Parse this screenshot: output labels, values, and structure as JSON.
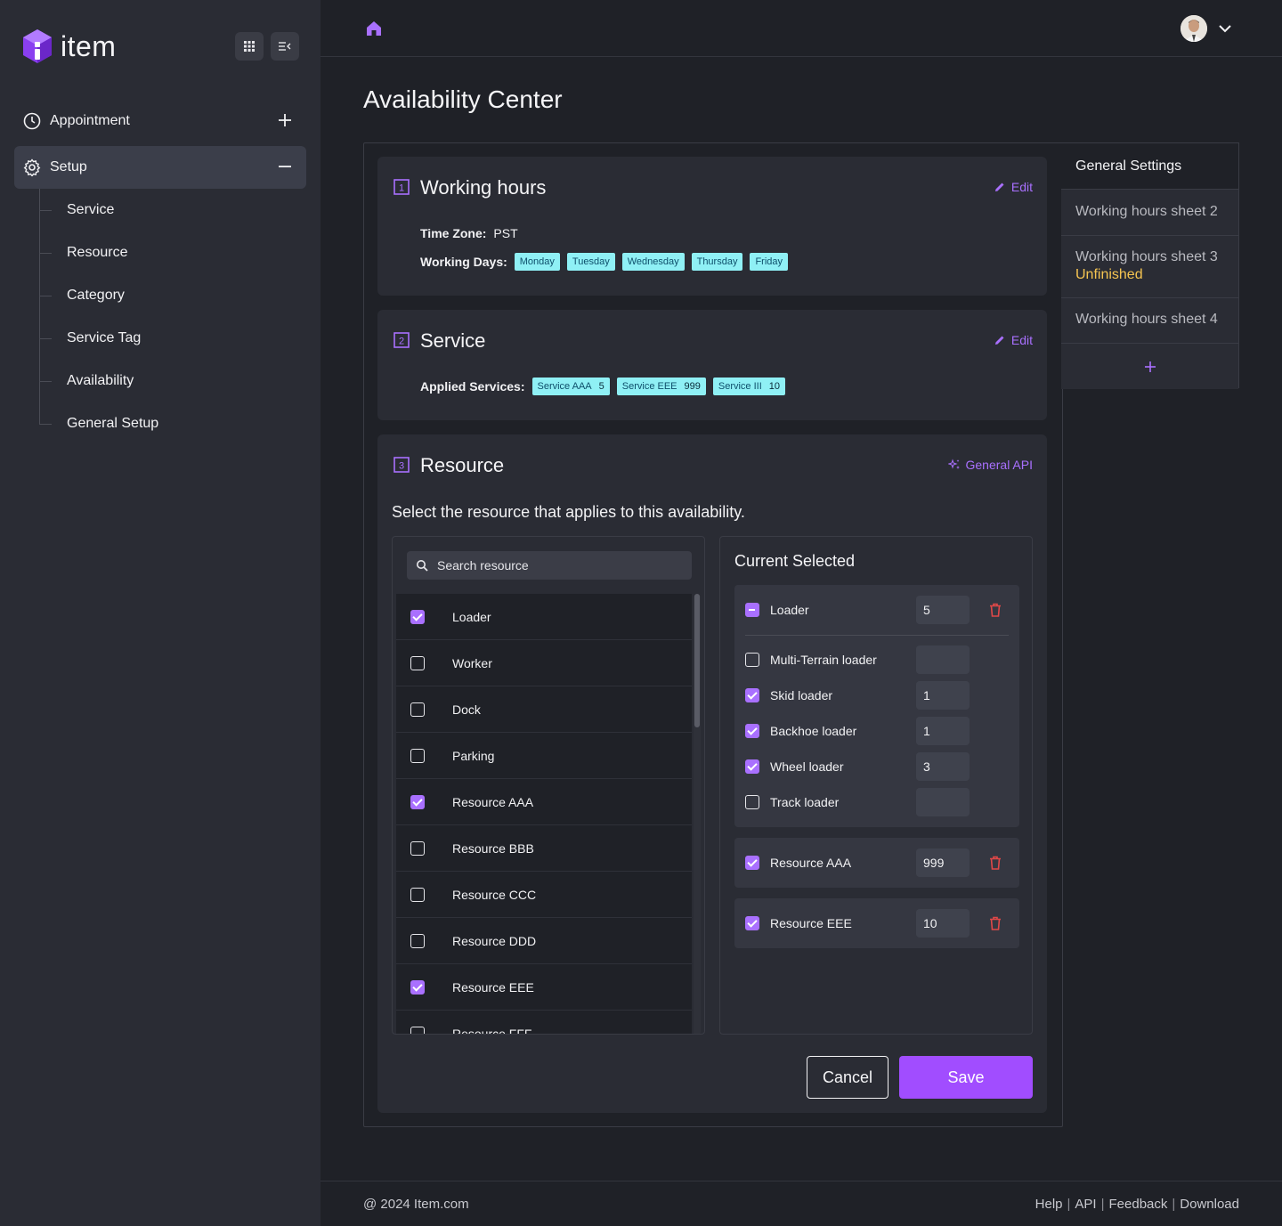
{
  "brand": {
    "name": "item",
    "accent": "#a970ff"
  },
  "sidebar": {
    "nav": [
      {
        "label": "Appointment",
        "icon": "clock-icon",
        "action": "plus-icon"
      },
      {
        "label": "Setup",
        "icon": "gear-icon",
        "action": "minus-icon"
      }
    ],
    "sub_items": [
      "Service",
      "Resource",
      "Category",
      "Service Tag",
      "Availability",
      "General Setup"
    ]
  },
  "page": {
    "title": "Availability Center"
  },
  "working_hours": {
    "step": "1",
    "title": "Working hours",
    "edit_label": "Edit",
    "time_zone_label": "Time Zone:",
    "time_zone": "PST",
    "working_days_label": "Working Days:",
    "days": [
      "Monday",
      "Tuesday",
      "Wednesday",
      "Thursday",
      "Friday"
    ]
  },
  "service": {
    "step": "2",
    "title": "Service",
    "edit_label": "Edit",
    "applied_label": "Applied Services:",
    "chips": [
      {
        "name": "Service AAA",
        "count": "5"
      },
      {
        "name": "Service EEE",
        "count": "999"
      },
      {
        "name": "Service III",
        "count": "10"
      }
    ]
  },
  "resource": {
    "step": "3",
    "title": "Resource",
    "api_label": "General API",
    "description": "Select the resource that applies to this availability.",
    "search_placeholder": "Search resource",
    "items": [
      {
        "label": "Loader",
        "checked": true
      },
      {
        "label": "Worker",
        "checked": false
      },
      {
        "label": "Dock",
        "checked": false
      },
      {
        "label": "Parking",
        "checked": false
      },
      {
        "label": "Resource AAA",
        "checked": true
      },
      {
        "label": "Resource BBB",
        "checked": false
      },
      {
        "label": "Resource CCC",
        "checked": false
      },
      {
        "label": "Resource DDD",
        "checked": false
      },
      {
        "label": "Resource EEE",
        "checked": true
      },
      {
        "label": "Resource FFF",
        "checked": false
      }
    ],
    "current_selected_title": "Current Selected",
    "loader_group": {
      "label": "Loader",
      "qty": "5",
      "children": [
        {
          "label": "Multi-Terrain loader",
          "checked": false,
          "qty": ""
        },
        {
          "label": "Skid loader",
          "checked": true,
          "qty": "1"
        },
        {
          "label": "Backhoe loader",
          "checked": true,
          "qty": "1"
        },
        {
          "label": "Wheel loader",
          "checked": true,
          "qty": "3"
        },
        {
          "label": "Track loader",
          "checked": false,
          "qty": ""
        }
      ]
    },
    "selected_groups": [
      {
        "label": "Resource AAA",
        "qty": "999"
      },
      {
        "label": "Resource EEE",
        "qty": "10"
      }
    ]
  },
  "actions": {
    "cancel": "Cancel",
    "save": "Save"
  },
  "side_tabs": [
    {
      "label": "General Settings",
      "status": ""
    },
    {
      "label": "Working hours sheet 2",
      "status": ""
    },
    {
      "label": "Working hours sheet 3",
      "status": "Unfinished"
    },
    {
      "label": "Working hours sheet 4",
      "status": ""
    }
  ],
  "footer": {
    "copyright": "@ 2024 Item.com",
    "links": [
      "Help",
      "API",
      "Feedback",
      "Download"
    ]
  }
}
